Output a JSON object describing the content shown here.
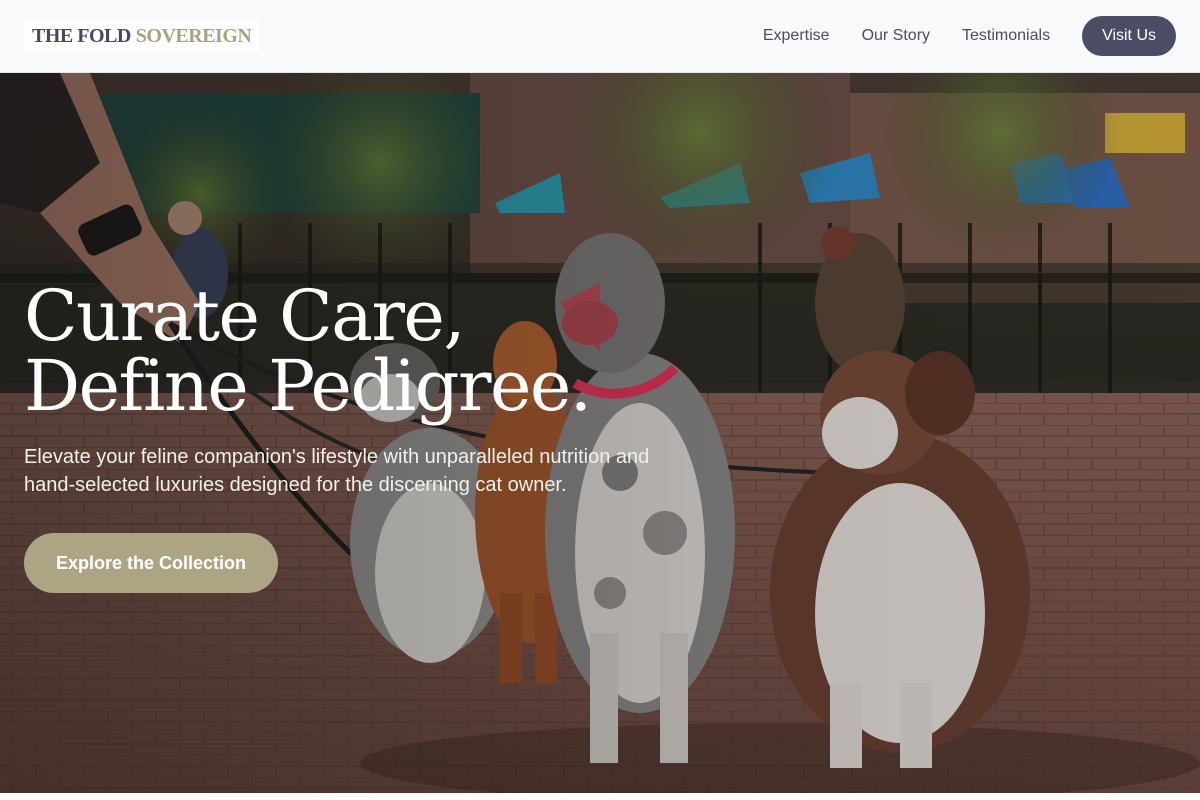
{
  "header": {
    "logo": {
      "primary": "THE FOLD",
      "accent": "SOVEREIGN"
    },
    "nav": [
      {
        "label": "Expertise"
      },
      {
        "label": "Our Story"
      },
      {
        "label": "Testimonials"
      }
    ],
    "visit_button": "Visit Us"
  },
  "hero": {
    "title_line1": "Curate Care,",
    "title_line2": "Define Pedigree.",
    "subtitle": "Elevate your feline companion's lifestyle with unparalleled nutrition and hand-selected luxuries designed for the discerning cat owner.",
    "cta_label": "Explore the Collection",
    "image_subject": "dogs-on-leashes-in-city-park-photo"
  },
  "colors": {
    "header_bg": "#f8f9fa",
    "logo_primary": "#454a5e",
    "logo_accent": "#a9a283",
    "nav_text": "#4b4f5c",
    "visit_button_bg": "#4a4d65",
    "cta_bg": "#aca584"
  }
}
